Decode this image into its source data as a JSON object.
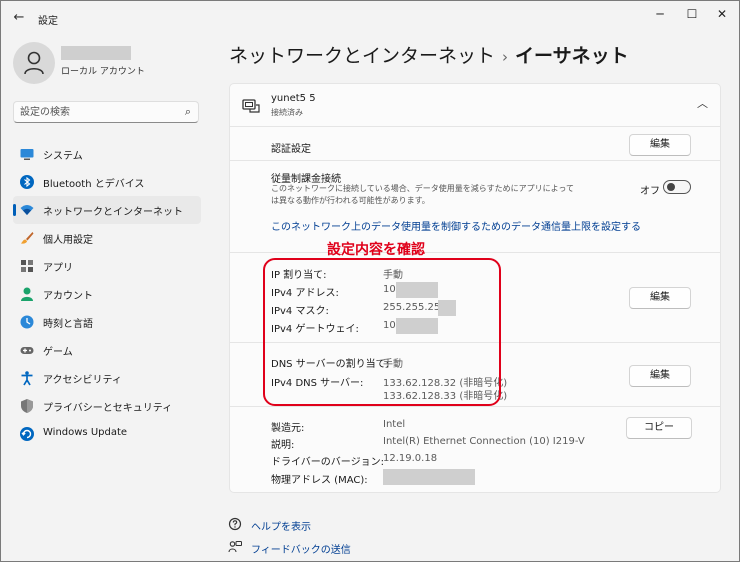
{
  "window": {
    "app_title": "設定",
    "back_glyph": "←",
    "minimize_glyph": "─",
    "maximize_glyph": "☐",
    "close_glyph": "✕"
  },
  "profile": {
    "account_type": "ローカル アカウント"
  },
  "search": {
    "placeholder": "設定の検索"
  },
  "sidebar": {
    "items": [
      {
        "label": "システム",
        "icon": "system-icon",
        "active": false
      },
      {
        "label": "Bluetooth とデバイス",
        "icon": "bluetooth-icon",
        "active": false
      },
      {
        "label": "ネットワークとインターネット",
        "icon": "wifi-icon",
        "active": true
      },
      {
        "label": "個人用設定",
        "icon": "brush-icon",
        "active": false
      },
      {
        "label": "アプリ",
        "icon": "apps-icon",
        "active": false
      },
      {
        "label": "アカウント",
        "icon": "account-icon",
        "active": false
      },
      {
        "label": "時刻と言語",
        "icon": "globe-clock-icon",
        "active": false
      },
      {
        "label": "ゲーム",
        "icon": "gamepad-icon",
        "active": false
      },
      {
        "label": "アクセシビリティ",
        "icon": "accessibility-icon",
        "active": false
      },
      {
        "label": "プライバシーとセキュリティ",
        "icon": "shield-icon",
        "active": false
      },
      {
        "label": "Windows Update",
        "icon": "update-icon",
        "active": false
      }
    ]
  },
  "header": {
    "parent": "ネットワークとインターネット",
    "separator": "›",
    "current": "イーサネット"
  },
  "card": {
    "network_name": "yunet5 5",
    "network_status": "接続済み",
    "chevron": "︿",
    "auth": {
      "label": "認証設定",
      "button": "編集"
    },
    "metered": {
      "label": "従量制課金接続",
      "description": "このネットワークに接続している場合、データ使用量を減らすためにアプリによっては異なる動作が行われる可能性があります。",
      "toggle_label": "オフ",
      "toggle_on": false
    },
    "data_limit_link": "このネットワーク上のデータ使用量を制御するためのデータ通信量上限を設定する",
    "ip": {
      "assign_label": "IP 割り当て:",
      "assign_value": "手動",
      "address_label": "IPv4 アドレス:",
      "address_value": "10.",
      "mask_label": "IPv4 マスク:",
      "mask_value": "255.255.255.",
      "gateway_label": "IPv4 ゲートウェイ:",
      "gateway_value": "10.",
      "button": "編集"
    },
    "dns": {
      "assign_label": "DNS サーバーの割り当て:",
      "assign_value": "手動",
      "server_label": "IPv4 DNS サーバー:",
      "server_1": "133.62.128.32 (非暗号化)",
      "server_2": "133.62.128.33 (非暗号化)",
      "button": "編集"
    },
    "hardware": {
      "manufacturer_label": "製造元:",
      "manufacturer_value": "Intel",
      "description_label": "説明:",
      "description_value": "Intel(R) Ethernet Connection (10) I219-V",
      "driver_label": "ドライバーのバージョン:",
      "driver_value": "12.19.0.18",
      "mac_label": "物理アドレス (MAC):",
      "copy_button": "コピー"
    }
  },
  "annotation": {
    "label": "設定内容を確認",
    "color": "#e0001a"
  },
  "footer": {
    "help": "ヘルプを表示",
    "feedback": "フィードバックの送信"
  },
  "colors": {
    "accent": "#005fb8",
    "link": "#003e92"
  }
}
